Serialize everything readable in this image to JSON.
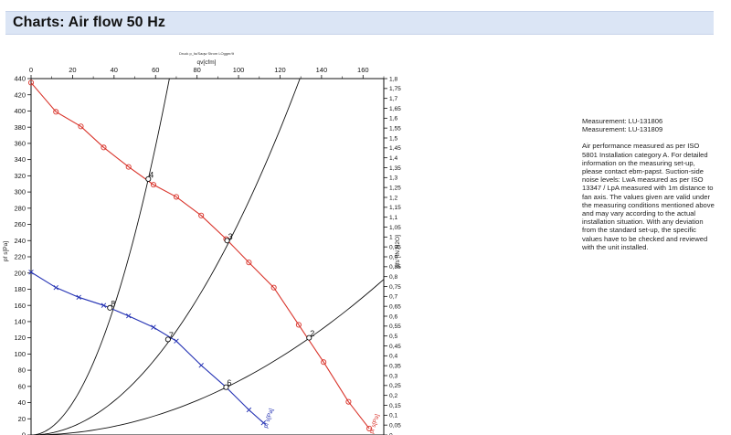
{
  "header": {
    "title": "Charts: Air flow 50 Hz"
  },
  "notes": {
    "measurement_1": "Measurement: LU-131806",
    "measurement_2": "Measurement: LU-131809",
    "description": "Air performance measured as per ISO 5801 Installation category A. For detailed information on the measuring set-up, please contact ebm-papst. Suction-side noise levels: LwA measured as per ISO 13347 / LpA measured with 1m distance to fan axis. The values given are valid under the measuring conditions mentioned above and may vary according to the actual installation situation. With any deviation from the standard set-up, the specific values have to be checked and reviewed with the unit installed."
  },
  "chart_data": {
    "type": "line",
    "title": "",
    "small_caption": "Druck p_fa/Saqw Strom LOgger/It",
    "x_axis": {
      "label": "qv[cfm]",
      "min": 0,
      "max": 170,
      "ticks": [
        "0",
        "20",
        "40",
        "60",
        "80",
        "100",
        "120",
        "140",
        "160"
      ]
    },
    "y_left": {
      "label": "pf s[Pa]",
      "min": 0,
      "max": 440,
      "ticks": [
        "0",
        "20",
        "40",
        "60",
        "80",
        "100",
        "120",
        "140",
        "160",
        "180",
        "200",
        "220",
        "240",
        "260",
        "280",
        "300",
        "320",
        "340",
        "360",
        "380",
        "400",
        "420",
        "440"
      ]
    },
    "y_right": {
      "label": "pfs [IN H2O]",
      "min": 0,
      "max": 1.8,
      "ticks": [
        "0",
        "0,05",
        "0,1",
        "0,15",
        "0,2",
        "0,25",
        "0,3",
        "0,35",
        "0,4",
        "0,45",
        "0,5",
        "0,55",
        "0,6",
        "0,65",
        "0,7",
        "0,75",
        "0,8",
        "0,85",
        "0,9",
        "0,95",
        "1",
        "1,05",
        "1,1",
        "1,15",
        "1,2",
        "1,25",
        "1,3",
        "1,35",
        "1,4",
        "1,45",
        "1,5",
        "1,55",
        "1,6",
        "1,65",
        "1,7",
        "1,75",
        "1,8"
      ]
    },
    "series": [
      {
        "color": "#d9342b",
        "marker": "circle",
        "end_label": "pf s[Pa]",
        "x": [
          0,
          12,
          24,
          35,
          47,
          59,
          70,
          82,
          94,
          105,
          117,
          129,
          141,
          153,
          163
        ],
        "y": [
          435,
          399,
          381,
          355,
          331,
          309,
          294,
          271,
          242,
          213,
          182,
          136,
          90,
          41,
          8
        ]
      },
      {
        "color": "#2230b3",
        "marker": "x",
        "end_label": "pf s[Pa]",
        "x": [
          0,
          12,
          23,
          35,
          47,
          59,
          70,
          82,
          94,
          105,
          112
        ],
        "y": [
          201,
          182,
          170,
          160,
          147,
          133,
          116,
          86,
          59,
          31,
          15
        ]
      }
    ],
    "system_curves": [
      {
        "k": 0.099,
        "max_y": 440
      },
      {
        "k": 0.0262,
        "max_y": 440
      },
      {
        "k": 0.00665,
        "max_y": 198
      }
    ],
    "operating_points": [
      {
        "label": "4",
        "x": 56.5,
        "y": 316
      },
      {
        "label": "3",
        "x": 94.5,
        "y": 240
      },
      {
        "label": "2",
        "x": 134,
        "y": 120
      },
      {
        "label": "8",
        "x": 38,
        "y": 157
      },
      {
        "label": "7",
        "x": 66,
        "y": 118
      },
      {
        "label": "6",
        "x": 94,
        "y": 59
      }
    ]
  }
}
